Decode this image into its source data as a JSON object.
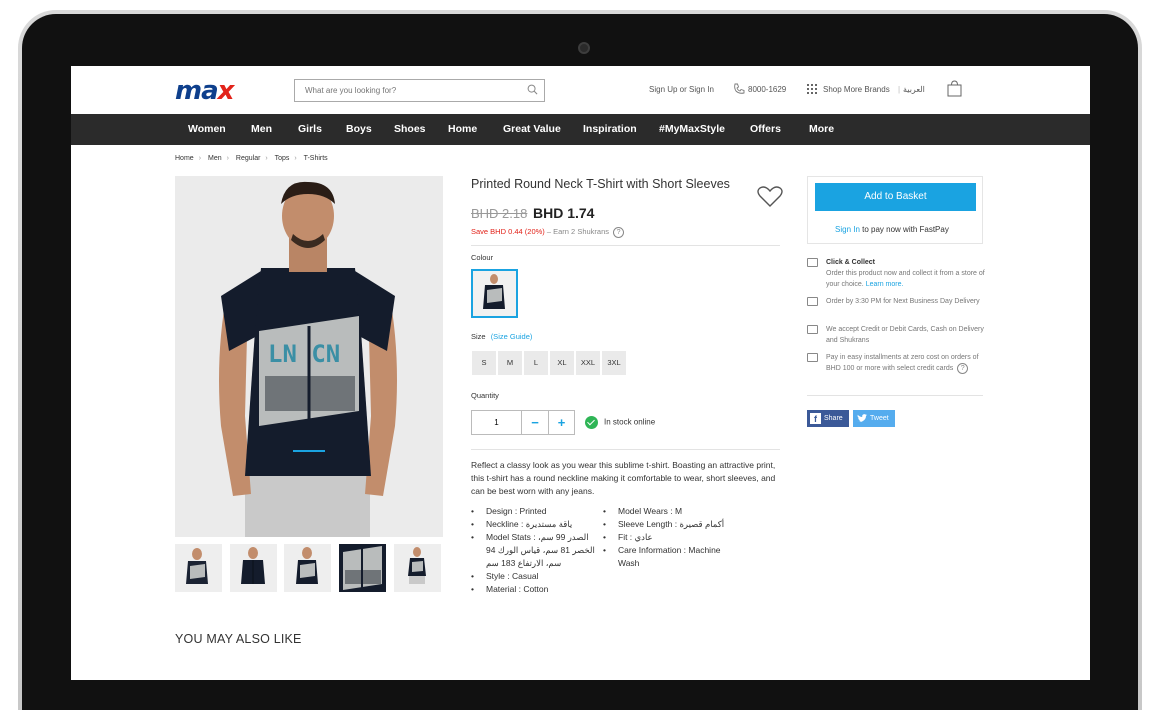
{
  "header": {
    "logo": "max",
    "search_placeholder": "What are you looking for?",
    "signin": "Sign Up or Sign In",
    "phone": "8000-1629",
    "brands": "Shop More Brands",
    "language": "العربية"
  },
  "nav": [
    "Women",
    "Men",
    "Girls",
    "Boys",
    "Shoes",
    "Home",
    "Great Value",
    "Inspiration",
    "#MyMaxStyle",
    "Offers",
    "More"
  ],
  "breadcrumb": [
    "Home",
    "Men",
    "Regular",
    "Tops",
    "T-Shirts"
  ],
  "product": {
    "title": "Printed Round Neck T-Shirt with Short Sleeves",
    "old_price": "BHD 2.18",
    "new_price": "BHD 1.74",
    "save": "Save BHD 0.44 (20%)",
    "earn": " – Earn 2 Shukrans",
    "colour_label": "Colour",
    "size_label": "Size",
    "size_guide": "(Size Guide)",
    "sizes": [
      "S",
      "M",
      "L",
      "XL",
      "XXL",
      "3XL"
    ],
    "quantity_label": "Quantity",
    "quantity": "1",
    "minus": "−",
    "plus": "+",
    "stock": "In stock online",
    "description": "Reflect a classy look as you wear this sublime t-shirt. Boasting an attractive print, this t-shirt has a round neckline making it comfortable to wear, short sleeves, and can be best worn with any jeans.",
    "details_left": [
      "Design : Printed",
      "Neckline : ياقة مستديرة",
      "Model Stats : الصدر 99 سم، الخصر 81 سم، قياس الورك 94 سم، الارتفاع 183 سم",
      "Style : Casual",
      "Material : Cotton"
    ],
    "details_right": [
      "Model Wears : M",
      "Sleeve Length : أكمام قصيرة",
      "Fit : عادي",
      "Care Information : Machine Wash"
    ],
    "print_text": "LN CN"
  },
  "sidebar": {
    "basket": "Add to Basket",
    "signin_link": "Sign In",
    "fastpay": " to pay now with FastPay",
    "click_collect_title": "Click & Collect",
    "click_collect": "Order this product now and collect it from a store of your choice.",
    "learn_more": "Learn more.",
    "order_by": "Order by 3:30 PM for Next Business Day Delivery",
    "payment": "We accept Credit or Debit Cards, Cash on Delivery and Shukrans",
    "installments": "Pay in easy installments at zero cost on orders of BHD 100 or more with select credit cards",
    "share": "Share",
    "tweet": "Tweet"
  },
  "recommendations": {
    "title": "YOU MAY ALSO LIKE"
  },
  "colors": {
    "accent": "#1aa3e1",
    "nav_bg": "#2b2b2b",
    "sale": "#e2231a",
    "logo_blue": "#0e3f8c",
    "facebook": "#3b5998",
    "twitter": "#55acee",
    "stock_green": "#2fb556"
  }
}
